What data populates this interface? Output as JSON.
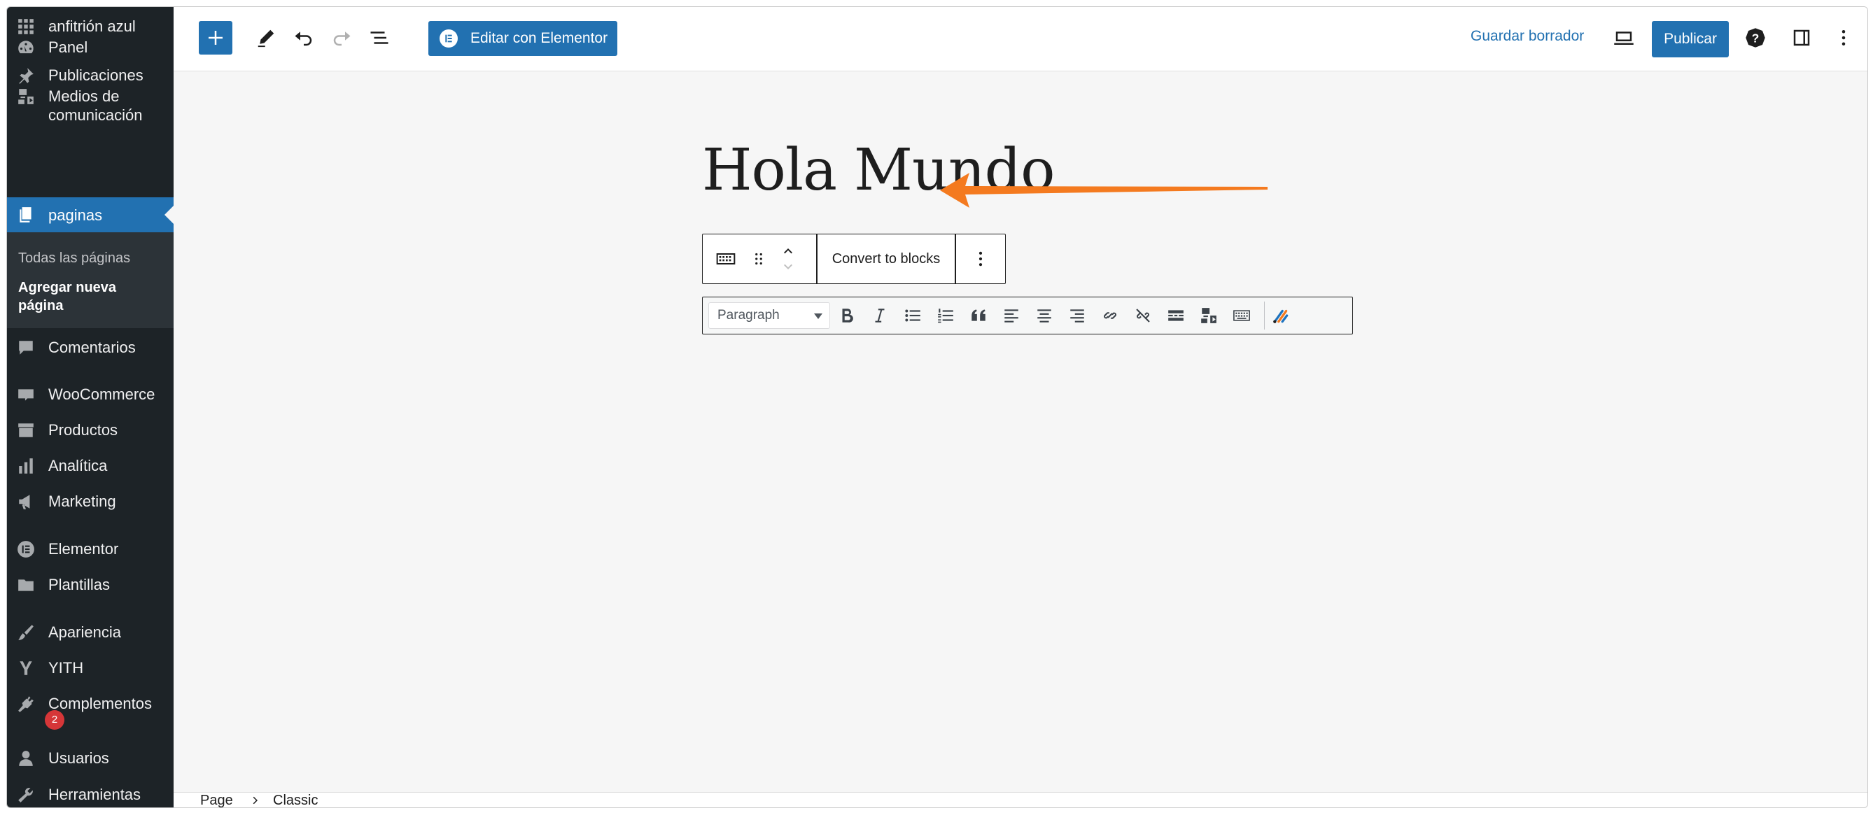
{
  "sidebar": {
    "site_name": "anfitrión azul",
    "items": [
      {
        "label": "Panel"
      },
      {
        "label": "Publicaciones"
      },
      {
        "label": "Medios de comunicación"
      },
      {
        "label": "paginas"
      },
      {
        "label": "Comentarios"
      },
      {
        "label": "WooCommerce"
      },
      {
        "label": "Productos"
      },
      {
        "label": "Analítica"
      },
      {
        "label": "Marketing"
      },
      {
        "label": "Elementor"
      },
      {
        "label": "Plantillas"
      },
      {
        "label": "Apariencia"
      },
      {
        "label": "YITH"
      },
      {
        "label": "Complementos",
        "badge": "2"
      },
      {
        "label": "Usuarios"
      },
      {
        "label": "Herramientas"
      }
    ],
    "submenu": [
      {
        "label": "Todas las páginas"
      },
      {
        "label": "Agregar nueva página"
      }
    ],
    "colors": {
      "background": "#1d2327",
      "active": "#2271b1",
      "badge": "#d63638"
    }
  },
  "topbar": {
    "edit_elementor_label": "Editar con Elementor",
    "save_draft_label": "Guardar borrador",
    "publish_label": "Publicar"
  },
  "editor": {
    "title": "Hola Mundo",
    "block_toolbar": {
      "convert_label": "Convert to blocks"
    },
    "classic_toolbar": {
      "format_value": "Paragraph",
      "buttons": [
        "bold",
        "italic",
        "bulleted-list",
        "numbered-list",
        "blockquote",
        "align-left",
        "align-center",
        "align-right",
        "insert-link",
        "remove-link",
        "read-more",
        "add-media",
        "toolbar-toggle",
        "plugin-button"
      ]
    }
  },
  "footer": {
    "breadcrumb": [
      "Page",
      "Classic"
    ]
  },
  "annotation": {
    "arrow_color": "#f47a1f"
  }
}
